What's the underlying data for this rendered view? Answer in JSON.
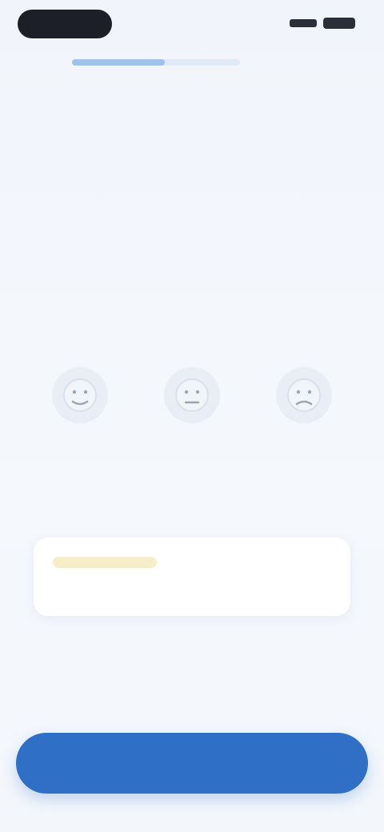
{
  "progress": 0.55,
  "header": {
    "skip_label": ""
  },
  "question": {
    "title": "",
    "subtitle": ""
  },
  "columns": [
    {
      "label": ""
    },
    {
      "label": ""
    },
    {
      "label": ""
    }
  ],
  "options": [
    {
      "label": ""
    },
    {
      "label": ""
    },
    {
      "label": ""
    }
  ],
  "tip": {
    "text": ""
  },
  "primary_action": {
    "label": ""
  },
  "colors": {
    "accent": "#2f6fc6",
    "background": "#f3f7fc",
    "progress_fill": "#9fc2ee",
    "progress_track": "#dfe9f7"
  }
}
